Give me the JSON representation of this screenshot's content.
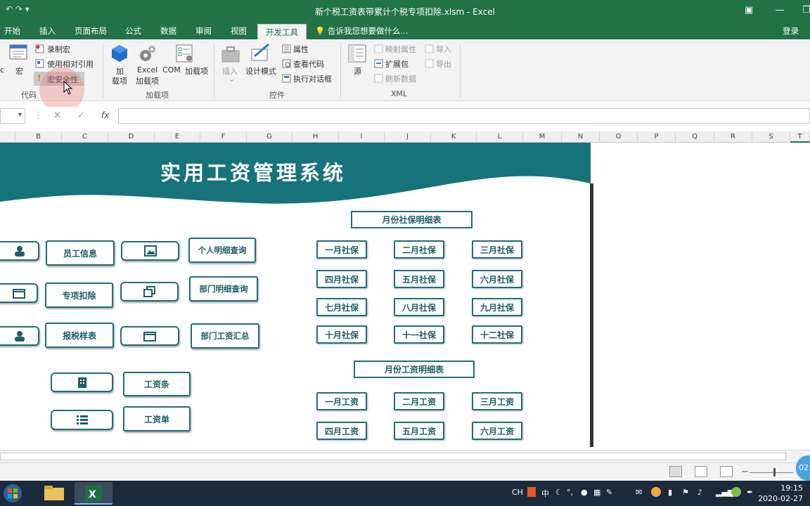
{
  "app": {
    "window_title": "新个税工资表带累计个税专项扣除.xlsm - Excel",
    "login_label": "登录",
    "tell_me": "告诉我您想要做什么..."
  },
  "tabs": [
    {
      "label": "开始"
    },
    {
      "label": "插入"
    },
    {
      "label": "页面布局"
    },
    {
      "label": "公式"
    },
    {
      "label": "数据"
    },
    {
      "label": "审阅"
    },
    {
      "label": "视图"
    },
    {
      "label": "开发工具",
      "active": true
    }
  ],
  "ribbon": {
    "code": {
      "vb_partial": "c",
      "macro": "宏",
      "record_macro": "录制宏",
      "relative_ref": "使用相对引用",
      "macro_security": "宏安全性",
      "group_label": "代码"
    },
    "addins": {
      "add": "加\n载项",
      "add_l1": "加",
      "add_l2": "载项",
      "excel_l1": "Excel",
      "excel_l2": "加载项",
      "com_l1": "COM",
      "com_l2": "加载项",
      "group_label": "加载项"
    },
    "controls": {
      "insert": "插入",
      "design_mode": "设计模式",
      "properties": "属性",
      "view_code": "查看代码",
      "run_dialog": "执行对话框",
      "group_label": "控件"
    },
    "xml": {
      "source": "源",
      "map_props": "映射属性",
      "expansion": "扩展包",
      "refresh": "刷新数据",
      "import": "导入",
      "export": "导出",
      "group_label": "XML"
    }
  },
  "formula_bar": {
    "fx": "fx",
    "cancel": "✕",
    "enter": "✓"
  },
  "columns": [
    "B",
    "C",
    "D",
    "E",
    "F",
    "G",
    "H",
    "I",
    "J",
    "K",
    "L",
    "M",
    "N",
    "O",
    "P",
    "Q",
    "R",
    "S",
    "T"
  ],
  "sheet": {
    "banner_title": "实用工资管理系统",
    "buttons": {
      "employee_info": "员工信息",
      "special_deduction": "专项扣除",
      "tax_sample": "报税样表",
      "personal_query": "个人明细查询",
      "dept_query": "部门明细查询",
      "dept_summary": "部门工资汇总",
      "payslip": "工资条",
      "payroll": "工资单"
    },
    "social_header": "月份社保明细表",
    "social_months": [
      "一月社保",
      "二月社保",
      "三月社保",
      "四月社保",
      "五月社保",
      "六月社保",
      "七月社保",
      "八月社保",
      "九月社保",
      "十月社保",
      "十一社保",
      "十二社保"
    ],
    "salary_header": "月份工资明细表",
    "salary_months": [
      "一月工资",
      "二月工资",
      "三月工资",
      "四月工资",
      "五月工资",
      "六月工资"
    ]
  },
  "status": {
    "zoom_minus": "−",
    "zoom_plus": "+",
    "badge": "02:"
  },
  "taskbar": {
    "ime": "CH",
    "ime_lang": "中",
    "time": "19:15",
    "date": "2020-02-27"
  },
  "colors": {
    "excel_green": "#217346",
    "banner_teal": "#16737a",
    "button_border": "#1f6f7a"
  }
}
